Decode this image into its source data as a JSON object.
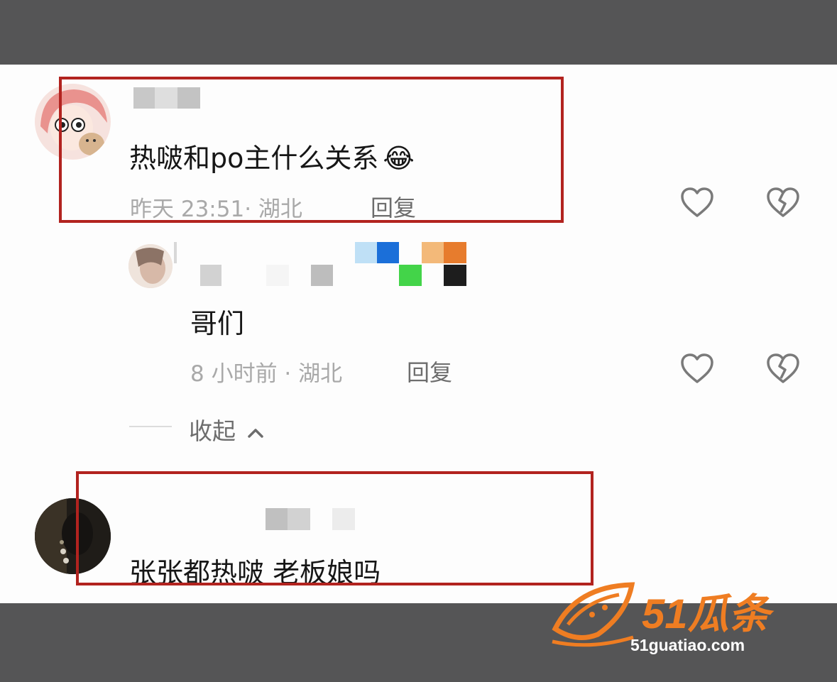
{
  "comments": [
    {
      "text": "热啵和po主什么关系",
      "emoji": "😂",
      "time_location": "昨天 23:51· 湖北",
      "reply_label": "回复"
    },
    {
      "text": "哥们",
      "time_location": "8 小时前 · 湖北",
      "reply_label": "回复"
    },
    {
      "text": "张张都热啵 老板娘吗"
    }
  ],
  "collapse_label": "收起",
  "icons": {
    "like": "heart-outline-icon",
    "dislike": "broken-heart-icon",
    "collapse": "chevron-up-icon"
  },
  "colors": {
    "highlight_box": "#b2231f",
    "meta_text": "#a9a9a9",
    "watermark_orange": "#ef7d22"
  },
  "watermark": {
    "logo_text": "51瓜条",
    "domain": "51guatiao.com"
  }
}
